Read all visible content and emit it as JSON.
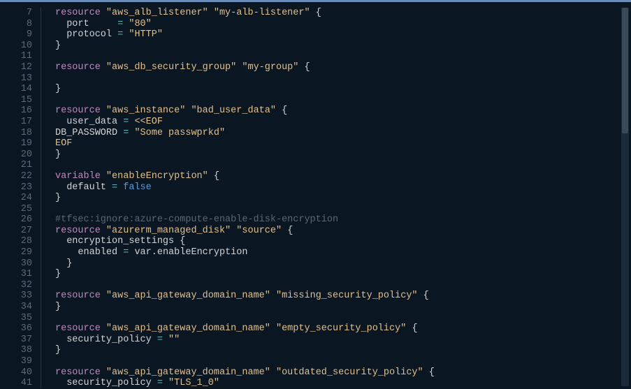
{
  "editor": {
    "startLine": 7,
    "endLine": 41,
    "lines": [
      {
        "n": 7,
        "seg": [
          {
            "c": "kw",
            "t": "resource"
          },
          {
            "c": "",
            "t": " "
          },
          {
            "c": "str",
            "t": "\"aws_alb_listener\""
          },
          {
            "c": "",
            "t": " "
          },
          {
            "c": "str",
            "t": "\"my-alb-listener\""
          },
          {
            "c": "",
            "t": " "
          },
          {
            "c": "punc",
            "t": "{"
          }
        ],
        "ind": 0
      },
      {
        "n": 8,
        "seg": [
          {
            "c": "attr",
            "t": "port     "
          },
          {
            "c": "op",
            "t": "="
          },
          {
            "c": "",
            "t": " "
          },
          {
            "c": "str",
            "t": "\"80\""
          }
        ],
        "ind": 1
      },
      {
        "n": 9,
        "seg": [
          {
            "c": "attr",
            "t": "protocol "
          },
          {
            "c": "op",
            "t": "="
          },
          {
            "c": "",
            "t": " "
          },
          {
            "c": "str",
            "t": "\"HTTP\""
          }
        ],
        "ind": 1
      },
      {
        "n": 10,
        "seg": [
          {
            "c": "punc",
            "t": "}"
          }
        ],
        "ind": 0
      },
      {
        "n": 11,
        "seg": [],
        "ind": 0
      },
      {
        "n": 12,
        "seg": [
          {
            "c": "kw",
            "t": "resource"
          },
          {
            "c": "",
            "t": " "
          },
          {
            "c": "str",
            "t": "\"aws_db_security_group\""
          },
          {
            "c": "",
            "t": " "
          },
          {
            "c": "str",
            "t": "\"my-group\""
          },
          {
            "c": "",
            "t": " "
          },
          {
            "c": "punc",
            "t": "{"
          }
        ],
        "ind": 0
      },
      {
        "n": 13,
        "seg": [],
        "ind": 0
      },
      {
        "n": 14,
        "seg": [
          {
            "c": "punc",
            "t": "}"
          }
        ],
        "ind": 0
      },
      {
        "n": 15,
        "seg": [],
        "ind": 0
      },
      {
        "n": 16,
        "seg": [
          {
            "c": "kw",
            "t": "resource"
          },
          {
            "c": "",
            "t": " "
          },
          {
            "c": "str",
            "t": "\"aws_instance\""
          },
          {
            "c": "",
            "t": " "
          },
          {
            "c": "str",
            "t": "\"bad_user_data\""
          },
          {
            "c": "",
            "t": " "
          },
          {
            "c": "punc",
            "t": "{"
          }
        ],
        "ind": 0
      },
      {
        "n": 17,
        "seg": [
          {
            "c": "attr",
            "t": "user_data "
          },
          {
            "c": "op",
            "t": "="
          },
          {
            "c": "",
            "t": " "
          },
          {
            "c": "heredoc",
            "t": "<<"
          },
          {
            "c": "heredoc",
            "t": "EOF"
          }
        ],
        "ind": 1
      },
      {
        "n": 18,
        "seg": [
          {
            "c": "attr",
            "t": "DB_PASSWORD "
          },
          {
            "c": "op",
            "t": "="
          },
          {
            "c": "",
            "t": " "
          },
          {
            "c": "str",
            "t": "\"Some passwprkd\""
          }
        ],
        "ind": 0,
        "raw": true
      },
      {
        "n": 19,
        "seg": [
          {
            "c": "heredoc",
            "t": "EOF"
          }
        ],
        "ind": 0,
        "raw": true
      },
      {
        "n": 20,
        "seg": [
          {
            "c": "punc",
            "t": "}"
          }
        ],
        "ind": 0
      },
      {
        "n": 21,
        "seg": [],
        "ind": 0
      },
      {
        "n": 22,
        "seg": [
          {
            "c": "kw",
            "t": "variable"
          },
          {
            "c": "",
            "t": " "
          },
          {
            "c": "str",
            "t": "\"enableEncryption\""
          },
          {
            "c": "",
            "t": " "
          },
          {
            "c": "punc",
            "t": "{"
          }
        ],
        "ind": 0
      },
      {
        "n": 23,
        "seg": [
          {
            "c": "attr",
            "t": "default "
          },
          {
            "c": "op",
            "t": "="
          },
          {
            "c": "",
            "t": " "
          },
          {
            "c": "bool",
            "t": "false"
          }
        ],
        "ind": 1
      },
      {
        "n": 24,
        "seg": [
          {
            "c": "punc",
            "t": "}"
          }
        ],
        "ind": 0
      },
      {
        "n": 25,
        "seg": [],
        "ind": 0
      },
      {
        "n": 26,
        "seg": [
          {
            "c": "comment",
            "t": "#tfsec:ignore:azure-compute-enable-disk-encryption"
          }
        ],
        "ind": 0
      },
      {
        "n": 27,
        "seg": [
          {
            "c": "kw",
            "t": "resource"
          },
          {
            "c": "",
            "t": " "
          },
          {
            "c": "str",
            "t": "\"azurerm_managed_disk\""
          },
          {
            "c": "",
            "t": " "
          },
          {
            "c": "str",
            "t": "\"source\""
          },
          {
            "c": "",
            "t": " "
          },
          {
            "c": "punc",
            "t": "{"
          }
        ],
        "ind": 0
      },
      {
        "n": 28,
        "seg": [
          {
            "c": "attr",
            "t": "encryption_settings "
          },
          {
            "c": "punc",
            "t": "{"
          }
        ],
        "ind": 1
      },
      {
        "n": 29,
        "seg": [
          {
            "c": "attr",
            "t": "enabled "
          },
          {
            "c": "op",
            "t": "="
          },
          {
            "c": "",
            "t": " "
          },
          {
            "c": "var",
            "t": "var"
          },
          {
            "c": "punc",
            "t": "."
          },
          {
            "c": "var",
            "t": "enableEncryption"
          }
        ],
        "ind": 2
      },
      {
        "n": 30,
        "seg": [
          {
            "c": "punc",
            "t": "}"
          }
        ],
        "ind": 1
      },
      {
        "n": 31,
        "seg": [
          {
            "c": "punc",
            "t": "}"
          }
        ],
        "ind": 0
      },
      {
        "n": 32,
        "seg": [],
        "ind": 0
      },
      {
        "n": 33,
        "seg": [
          {
            "c": "kw",
            "t": "resource"
          },
          {
            "c": "",
            "t": " "
          },
          {
            "c": "str",
            "t": "\"aws_api_gateway_domain_name\""
          },
          {
            "c": "",
            "t": " "
          },
          {
            "c": "str",
            "t": "\"missing_security_policy\""
          },
          {
            "c": "",
            "t": " "
          },
          {
            "c": "punc",
            "t": "{"
          }
        ],
        "ind": 0
      },
      {
        "n": 34,
        "seg": [
          {
            "c": "punc",
            "t": "}"
          }
        ],
        "ind": 0
      },
      {
        "n": 35,
        "seg": [],
        "ind": 0
      },
      {
        "n": 36,
        "seg": [
          {
            "c": "kw",
            "t": "resource"
          },
          {
            "c": "",
            "t": " "
          },
          {
            "c": "str",
            "t": "\"aws_api_gateway_domain_name\""
          },
          {
            "c": "",
            "t": " "
          },
          {
            "c": "str",
            "t": "\"empty_security_policy\""
          },
          {
            "c": "",
            "t": " "
          },
          {
            "c": "punc",
            "t": "{"
          }
        ],
        "ind": 0
      },
      {
        "n": 37,
        "seg": [
          {
            "c": "attr",
            "t": "security_policy "
          },
          {
            "c": "op",
            "t": "="
          },
          {
            "c": "",
            "t": " "
          },
          {
            "c": "str",
            "t": "\"\""
          }
        ],
        "ind": 1
      },
      {
        "n": 38,
        "seg": [
          {
            "c": "punc",
            "t": "}"
          }
        ],
        "ind": 0
      },
      {
        "n": 39,
        "seg": [],
        "ind": 0
      },
      {
        "n": 40,
        "seg": [
          {
            "c": "kw",
            "t": "resource"
          },
          {
            "c": "",
            "t": " "
          },
          {
            "c": "str",
            "t": "\"aws_api_gateway_domain_name\""
          },
          {
            "c": "",
            "t": " "
          },
          {
            "c": "str",
            "t": "\"outdated_security_policy\""
          },
          {
            "c": "",
            "t": " "
          },
          {
            "c": "punc",
            "t": "{"
          }
        ],
        "ind": 0
      },
      {
        "n": 41,
        "seg": [
          {
            "c": "attr",
            "t": "security_policy "
          },
          {
            "c": "op",
            "t": "="
          },
          {
            "c": "",
            "t": " "
          },
          {
            "c": "str",
            "t": "\"TLS_1_0\""
          }
        ],
        "ind": 1
      }
    ]
  }
}
